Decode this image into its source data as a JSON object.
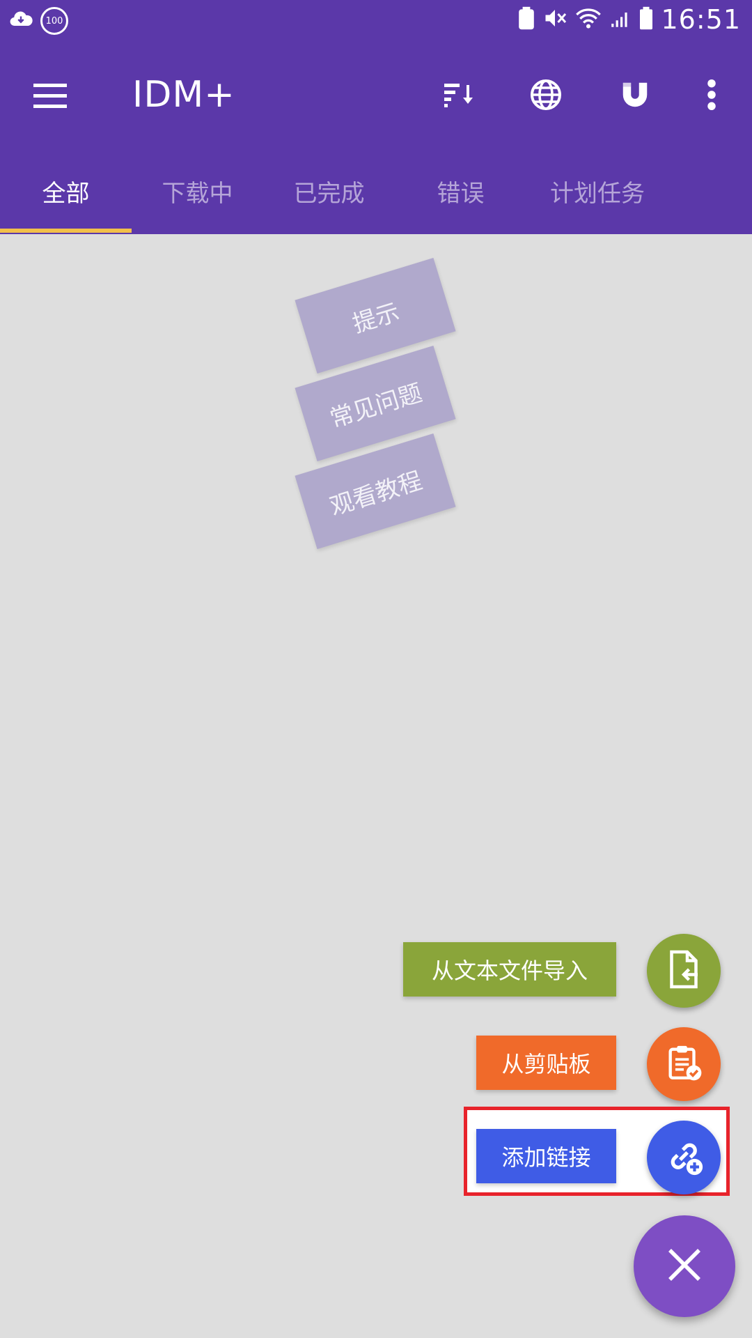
{
  "status_bar": {
    "time": "16:51",
    "badge": "100"
  },
  "toolbar": {
    "title": "IDM+"
  },
  "tabs": [
    {
      "label": "全部",
      "active": true
    },
    {
      "label": "下载中",
      "active": false
    },
    {
      "label": "已完成",
      "active": false
    },
    {
      "label": "错误",
      "active": false
    },
    {
      "label": "计划任务",
      "active": false
    }
  ],
  "hints": {
    "tips": "提示",
    "faq": "常见问题",
    "tutorial": "观看教程"
  },
  "fab_menu": {
    "import_text": "从文本文件导入",
    "from_clipboard": "从剪贴板",
    "add_link": "添加链接"
  },
  "colors": {
    "appbar": "#5b38a9",
    "import_green": "#8aa53a",
    "clipboard_orange": "#f06a2a",
    "link_blue": "#3f5ce6",
    "main_fab": "#7e4ec4",
    "highlight_red": "#e8232b"
  },
  "icons": [
    "menu-icon",
    "sort-icon",
    "browser-icon",
    "magnet-icon",
    "more-vert-icon",
    "file-import-icon",
    "clipboard-check-icon",
    "link-add-icon",
    "close-icon"
  ]
}
